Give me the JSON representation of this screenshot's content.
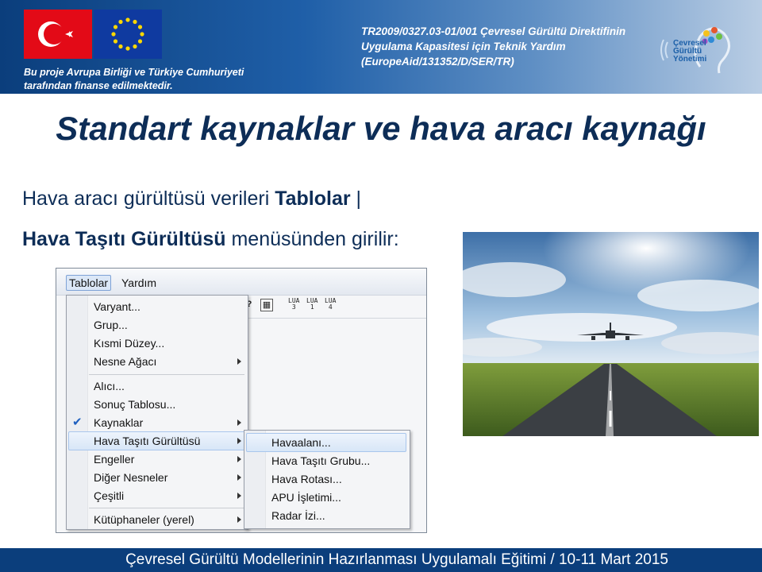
{
  "header": {
    "funded_line1": "Bu proje Avrupa Birliği ve Türkiye Cumhuriyeti",
    "funded_line2": "tarafından finanse edilmektedir.",
    "project_line1": "TR2009/0327.03-01/001 Çevresel Gürültü Direktifinin",
    "project_line2": "Uygulama Kapasitesi için Teknik Yardım",
    "project_line3": "(EuropeAid/131352/D/SER/TR)",
    "logo_line1": "Çevresel",
    "logo_line2": "Gürültü",
    "logo_line3": "Yönetimi",
    "icons": [
      "turkey-flag",
      "eu-flag",
      "noise-management-logo"
    ]
  },
  "slide": {
    "title": "Standart kaynaklar ve hava aracı kaynağı",
    "bullet1_text": "Hava aracı gürültüsü verileri ",
    "bullet1_bold": "Tablolar",
    "bullet1_bar": "|",
    "bullet2_bold": "Hava Taşıtı Gürültüsü",
    "bullet2_text": " menüsünden girilir:"
  },
  "app": {
    "menubar": [
      "Tablolar",
      "Yardım"
    ],
    "toolbar_lua": [
      {
        "top": "LUA",
        "bottom": "3"
      },
      {
        "top": "LUA",
        "bottom": "1"
      },
      {
        "top": "LUA",
        "bottom": "4"
      }
    ],
    "menu": {
      "items": [
        {
          "label": "Varyant..."
        },
        {
          "label": "Grup..."
        },
        {
          "label": "Kısmi Düzey..."
        },
        {
          "label": "Nesne Ağacı"
        },
        {
          "label": "Alıcı..."
        },
        {
          "label": "Sonuç Tablosu..."
        },
        {
          "label": "Kaynaklar"
        },
        {
          "label": "Hava Taşıtı Gürültüsü"
        },
        {
          "label": "Engeller"
        },
        {
          "label": "Diğer Nesneler"
        },
        {
          "label": "Çeşitli"
        },
        {
          "label": "Kütüphaneler (yerel)"
        }
      ],
      "checked_item": "Kaynaklar",
      "highlighted_item": "Hava Taşıtı Gürültüsü"
    },
    "submenu": {
      "items": [
        "Havaalanı...",
        "Hava Taşıtı Grubu...",
        "Hava Rotası...",
        "APU İşletimi...",
        "Radar İzi..."
      ]
    }
  },
  "footer": {
    "text": "Çevresel Gürültü Modellerinin Hazırlanması Uygulamalı Eğitimi / 10-11 Mart 2015"
  },
  "colors": {
    "title": "#0d2d57",
    "header_blue": "#0b3e7c",
    "menu_highlight": "#d8e6f7",
    "check": "#1e5fbf"
  }
}
